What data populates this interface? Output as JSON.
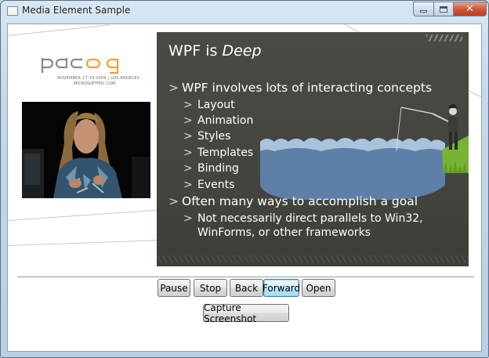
{
  "window": {
    "title": "Media Element Sample"
  },
  "video": {
    "logo_text": "pdc09",
    "logo_line1": "NOVEMBER 17-19 2009 | LOS ANGELES",
    "logo_line2": "MICROSOFTPDC.COM",
    "slide": {
      "title_main": "WPF is ",
      "title_emph": "Deep",
      "bullets": [
        {
          "text": "WPF involves lots of interacting concepts",
          "sub": [
            "Layout",
            "Animation",
            "Styles",
            "Templates",
            "Binding",
            "Events"
          ]
        },
        {
          "text": "Often many ways to accomplish a goal",
          "sub": [
            "Not necessarily direct parallels to Win32,",
            "WinForms, or other frameworks"
          ]
        }
      ]
    }
  },
  "controls": {
    "pause": "Pause",
    "stop": "Stop",
    "back": "Back",
    "forward": "Forward",
    "open": "Open",
    "capture": "Capture Screenshot"
  },
  "colors": {
    "slide_bg": "#45453f",
    "water": "#5d7fa8",
    "grass": "#7fb93a",
    "focus_border": "#3c7fb1"
  },
  "icons": [
    "app-icon",
    "minimize-icon",
    "maximize-icon",
    "close-icon"
  ]
}
